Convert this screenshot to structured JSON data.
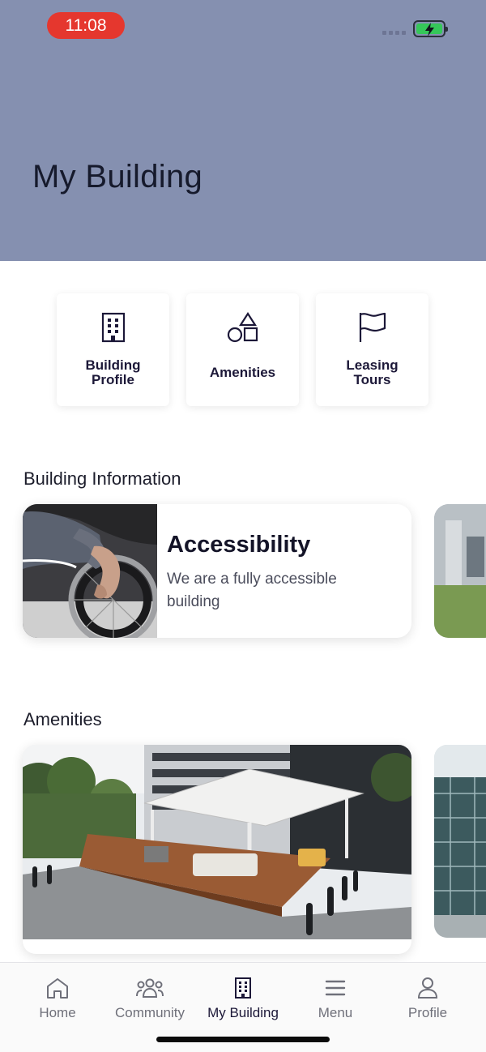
{
  "status_bar": {
    "time": "11:08"
  },
  "header": {
    "title": "My Building"
  },
  "quick_actions": [
    {
      "label": "Building\nProfile",
      "icon": "building-icon"
    },
    {
      "label": "Amenities",
      "icon": "shapes-icon"
    },
    {
      "label": "Leasing\nTours",
      "icon": "flag-icon"
    }
  ],
  "sections": {
    "building_information": "Building Information",
    "amenities": "Amenities"
  },
  "info_card": {
    "title": "Accessibility",
    "description": "We are a fully accessible building",
    "image": "wheelchair-photo"
  },
  "amenity_card": {
    "image": "outdoor-terrace-photo"
  },
  "tab_bar": {
    "items": [
      {
        "label": "Home",
        "icon": "home-icon",
        "active": false
      },
      {
        "label": "Community",
        "icon": "people-icon",
        "active": false
      },
      {
        "label": "My Building",
        "icon": "building-icon",
        "active": true
      },
      {
        "label": "Menu",
        "icon": "menu-icon",
        "active": false
      },
      {
        "label": "Profile",
        "icon": "person-icon",
        "active": false
      }
    ]
  },
  "colors": {
    "header_bg": "#8590b0",
    "time_pill": "#e5372e",
    "battery_fill": "#35c759",
    "text_dark": "#1c1838"
  }
}
